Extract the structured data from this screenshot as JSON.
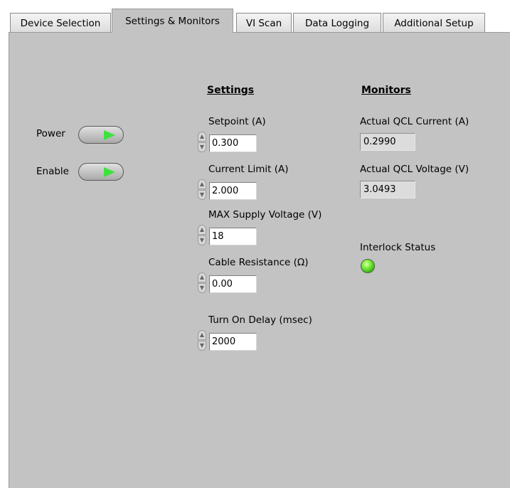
{
  "tabs": [
    {
      "label": "Device Selection",
      "active": false
    },
    {
      "label": "Settings & Monitors",
      "active": true
    },
    {
      "label": "VI Scan",
      "active": false
    },
    {
      "label": "Data Logging",
      "active": false
    },
    {
      "label": "Additional Setup",
      "active": false
    }
  ],
  "buttons": {
    "power_label": "Power",
    "enable_label": "Enable"
  },
  "settings": {
    "heading": "Settings",
    "setpoint": {
      "label": "Setpoint (A)",
      "value": "0.300"
    },
    "current_limit": {
      "label": "Current Limit (A)",
      "value": "2.000"
    },
    "max_supply_voltage": {
      "label": "MAX Supply Voltage (V)",
      "value": "18"
    },
    "cable_resistance": {
      "label": "Cable Resistance (Ω)",
      "value": "0.00"
    },
    "turn_on_delay": {
      "label": "Turn On Delay (msec)",
      "value": "2000"
    }
  },
  "monitors": {
    "heading": "Monitors",
    "actual_current": {
      "label": "Actual QCL Current (A)",
      "value": "0.2990"
    },
    "actual_voltage": {
      "label": "Actual QCL Voltage (V)",
      "value": "3.0493"
    },
    "interlock": {
      "label": "Interlock Status",
      "state": "on",
      "color": "#5ce02a"
    }
  },
  "colors": {
    "panel_bg": "#c3c3c3",
    "toggle_arrow": "#3ee23e"
  }
}
